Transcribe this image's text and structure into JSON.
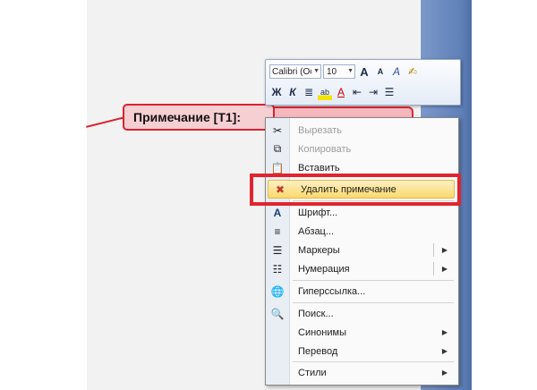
{
  "comment": {
    "label": "Примечание [T1]:"
  },
  "mini_toolbar": {
    "font": "Calibri (Oci",
    "size": "10",
    "row1": [
      "A",
      "A",
      "A",
      "✍"
    ],
    "row2": [
      "Ж",
      "К",
      "≣",
      "ab",
      "A",
      "⇤",
      "⇥",
      "☰"
    ]
  },
  "context_menu": {
    "items": [
      {
        "label": "Вырезать",
        "icon": "scissors-icon",
        "enabled": false
      },
      {
        "label": "Копировать",
        "icon": "copy-icon",
        "enabled": false
      },
      {
        "label": "Вставить",
        "icon": "paste-icon",
        "enabled": true
      },
      {
        "label": "Удалить примечание",
        "icon": "delete-comment-icon",
        "enabled": true,
        "highlighted": true
      },
      {
        "label": "Шрифт...",
        "icon": "font-icon",
        "enabled": true
      },
      {
        "label": "Абзац...",
        "icon": "paragraph-icon",
        "enabled": true
      },
      {
        "label": "Маркеры",
        "icon": "bullets-icon",
        "enabled": true,
        "submenu": true
      },
      {
        "label": "Нумерация",
        "icon": "numbering-icon",
        "enabled": true,
        "submenu": true
      },
      {
        "label": "Гиперссылка...",
        "icon": "hyperlink-icon",
        "enabled": true
      },
      {
        "label": "Поиск...",
        "icon": "search-icon",
        "enabled": true
      },
      {
        "label": "Синонимы",
        "icon": "",
        "enabled": true,
        "submenu": true
      },
      {
        "label": "Перевод",
        "icon": "",
        "enabled": true,
        "submenu": true
      },
      {
        "label": "Стили",
        "icon": "",
        "enabled": true,
        "submenu": true
      }
    ]
  },
  "colors": {
    "highlight_frame": "#e0252e",
    "comment_border": "#d9232f",
    "menu_hover": "#fbd96d"
  }
}
